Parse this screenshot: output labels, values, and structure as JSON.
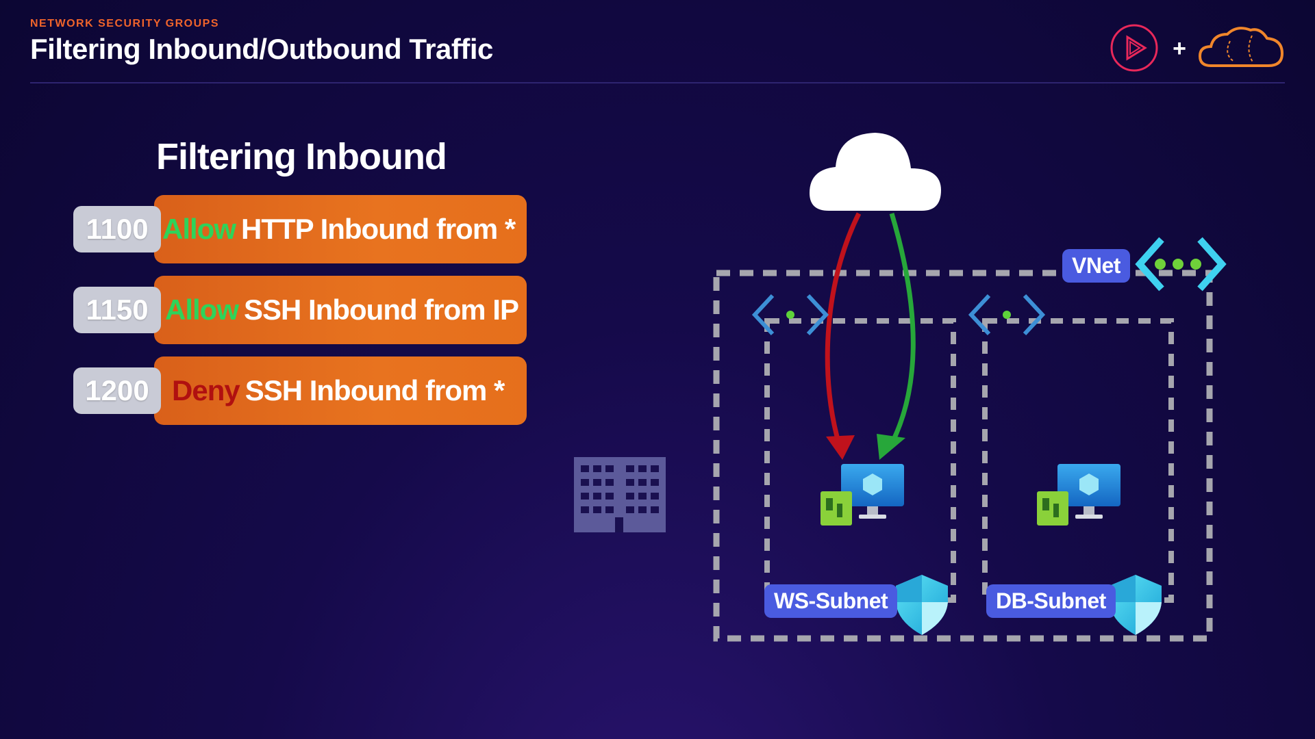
{
  "header": {
    "eyebrow": "NETWORK SECURITY GROUPS",
    "title": "Filtering Inbound/Outbound Traffic",
    "plus": "+"
  },
  "section_title": "Filtering Inbound",
  "rules": [
    {
      "priority": "1100",
      "action": "Allow",
      "text": "HTTP Inbound from *"
    },
    {
      "priority": "1150",
      "action": "Allow",
      "text": "SSH Inbound from IP"
    },
    {
      "priority": "1200",
      "action": "Deny",
      "text": "SSH Inbound from *"
    }
  ],
  "diagram": {
    "vnet_label": "VNet",
    "subnets": [
      {
        "label": "WS-Subnet"
      },
      {
        "label": "DB-Subnet"
      }
    ]
  },
  "colors": {
    "allow": "#2ed35a",
    "deny": "#b01010",
    "rule_bar": "#e8731f",
    "tag": "#4a5be0",
    "accent": "#f0642b"
  },
  "icons": [
    "pluralsight-logo",
    "cloud-logo",
    "internet-cloud-icon",
    "building-icon",
    "vm-icon",
    "nic-icon",
    "shield-icon",
    "vnet-icon",
    "subnet-icon"
  ]
}
